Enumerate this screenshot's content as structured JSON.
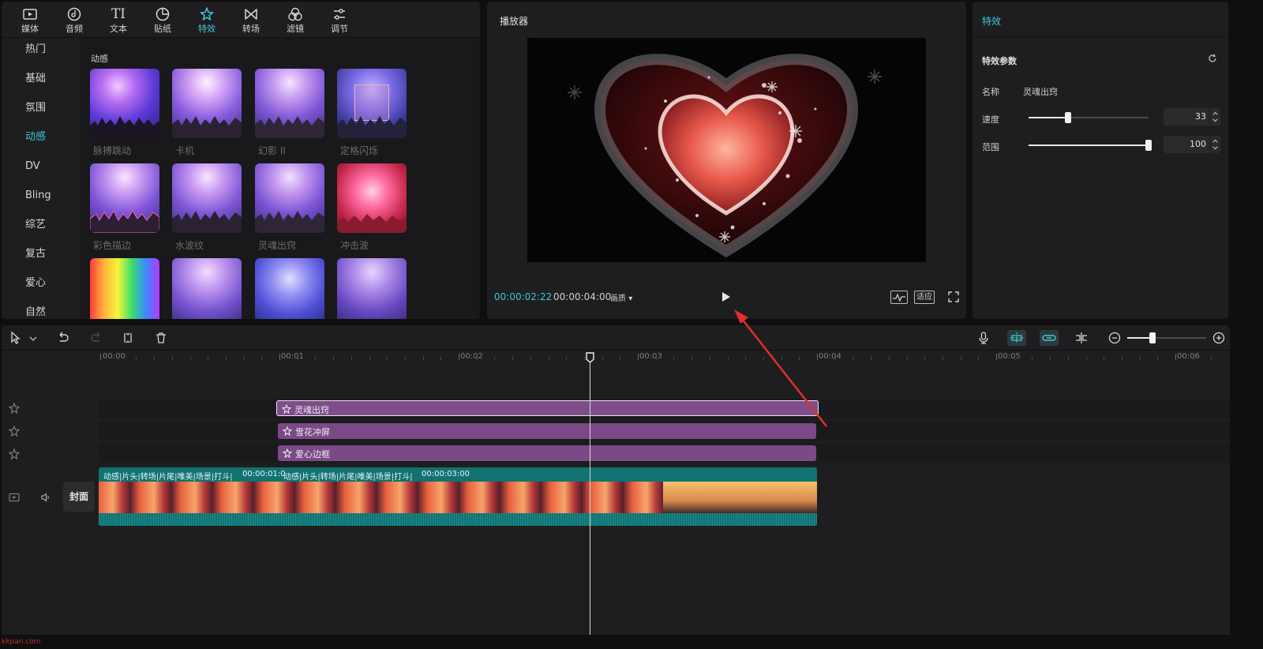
{
  "left_panel": {
    "tabs": [
      {
        "label": "媒体",
        "icon": "media-icon"
      },
      {
        "label": "音频",
        "icon": "audio-icon"
      },
      {
        "label": "文本",
        "icon": "text-icon"
      },
      {
        "label": "贴纸",
        "icon": "sticker-icon"
      },
      {
        "label": "特效",
        "icon": "effects-icon",
        "active": true
      },
      {
        "label": "转场",
        "icon": "transition-icon"
      },
      {
        "label": "滤镜",
        "icon": "filter-icon"
      },
      {
        "label": "调节",
        "icon": "adjust-icon"
      }
    ],
    "text_icon_glyph": "TI",
    "categories": [
      "热门",
      "基础",
      "氛围",
      "动感",
      "DV",
      "Bling",
      "综艺",
      "复古",
      "爱心",
      "自然"
    ],
    "active_category": "动感",
    "gallery_heading": "动感",
    "effects": [
      "脉搏跳动",
      "卡机",
      "幻影 II",
      "定格闪烁",
      "彩色描边",
      "水波纹",
      "灵魂出窍",
      "冲击波"
    ]
  },
  "player": {
    "title": "播放器",
    "current_time": "00:00:02:22",
    "total_time": "00:00:04:00",
    "quality_label": "画质",
    "fit_label": "适应"
  },
  "props": {
    "title": "特效",
    "section": "特效参数",
    "name_label": "名称",
    "name_value": "灵魂出窍",
    "speed_label": "速度",
    "speed_value": "33",
    "speed_level": 33,
    "range_label": "范围",
    "range_value": "100",
    "range_level": 100
  },
  "timeline": {
    "ruler": [
      "00:00",
      "00:01",
      "00:02",
      "00:03",
      "00:04",
      "00:05",
      "00:06"
    ],
    "effect_clips": [
      "灵魂出窍",
      "雪花冲屏",
      "爱心边框"
    ],
    "video_strip_1": "动感|片头|转场|片尾|唯美|场景|打斗|",
    "video_strip_1_time": "00:00:01:0",
    "video_strip_2": "动感|片头|转场|片尾|唯美|场景|打斗|",
    "video_strip_2_time": "00:00:03:00",
    "cover_label": "封面"
  },
  "watermark": "kkpan.com",
  "colors": {
    "accent": "#3ec6d9",
    "effect_clip": "#7b4a86",
    "video_clip": "#127272",
    "arrow": "#e0302a"
  }
}
